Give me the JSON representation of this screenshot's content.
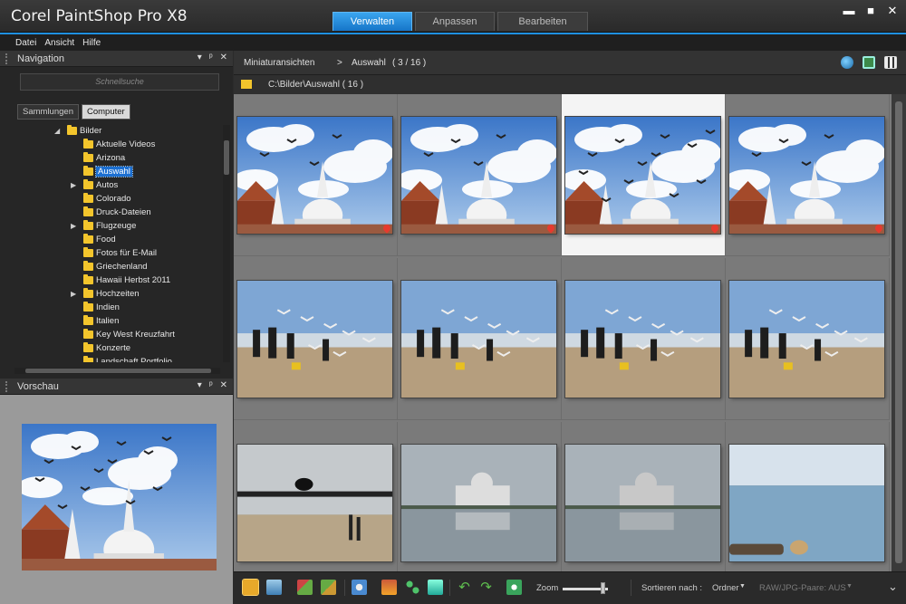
{
  "window": {
    "title": "Corel PaintShop Pro X8",
    "controls": [
      "▬",
      "■",
      "✕"
    ]
  },
  "tabs": [
    {
      "label": "Verwalten",
      "active": true
    },
    {
      "label": "Anpassen",
      "active": false
    },
    {
      "label": "Bearbeiten",
      "active": false
    }
  ],
  "menu": [
    "Datei",
    "Ansicht",
    "Hilfe"
  ],
  "navigation": {
    "title": "Navigation",
    "search_placeholder": "Schnellsuche",
    "tabs": [
      {
        "label": "Sammlungen",
        "selected": false
      },
      {
        "label": "Computer",
        "selected": true
      }
    ],
    "tree": [
      {
        "label": "Bilder",
        "level": 0,
        "expanded": true
      },
      {
        "label": "Aktuelle Videos",
        "level": 1
      },
      {
        "label": "Arizona",
        "level": 1
      },
      {
        "label": "Auswahl",
        "level": 1,
        "selected": true
      },
      {
        "label": "Autos",
        "level": 1,
        "collapsed": true
      },
      {
        "label": "Colorado",
        "level": 1
      },
      {
        "label": "Druck-Dateien",
        "level": 1
      },
      {
        "label": "Flugzeuge",
        "level": 1,
        "collapsed": true
      },
      {
        "label": "Food",
        "level": 1
      },
      {
        "label": "Fotos für E-Mail",
        "level": 1
      },
      {
        "label": "Griechenland",
        "level": 1
      },
      {
        "label": "Hawaii Herbst 2011",
        "level": 1
      },
      {
        "label": "Hochzeiten",
        "level": 1,
        "collapsed": true
      },
      {
        "label": "Indien",
        "level": 1
      },
      {
        "label": "Italien",
        "level": 1
      },
      {
        "label": "Key West Kreuzfahrt",
        "level": 1
      },
      {
        "label": "Konzerte",
        "level": 1
      },
      {
        "label": "Landschaft Portfolio",
        "level": 1
      }
    ]
  },
  "preview": {
    "title": "Vorschau"
  },
  "breadcrumb": {
    "root": "Miniaturansichten",
    "sep": ">",
    "current": "Auswahl",
    "count": "( 3 / 16 )"
  },
  "path": "C:\\Bilder\\Auswahl ( 16 )",
  "thumbnails": [
    {
      "scene": "stupa",
      "geotag": true
    },
    {
      "scene": "stupa",
      "geotag": true
    },
    {
      "scene": "stupa-birds",
      "geotag": true,
      "selected": true
    },
    {
      "scene": "stupa",
      "geotag": true
    },
    {
      "scene": "beach"
    },
    {
      "scene": "beach"
    },
    {
      "scene": "beach"
    },
    {
      "scene": "beach"
    },
    {
      "scene": "crow"
    },
    {
      "scene": "palace"
    },
    {
      "scene": "palace-far"
    },
    {
      "scene": "sea-dog"
    }
  ],
  "toolbar": {
    "zoom_label": "Zoom",
    "zoom_level": 0.8,
    "sort_label": "Sortieren nach :",
    "sort_value": "Ordner",
    "raw_label": "RAW/JPG-Paare: AUS"
  },
  "colors": {
    "accent": "#1f90e0",
    "geotag": "#e63a2e",
    "folder": "#f3c52c"
  }
}
